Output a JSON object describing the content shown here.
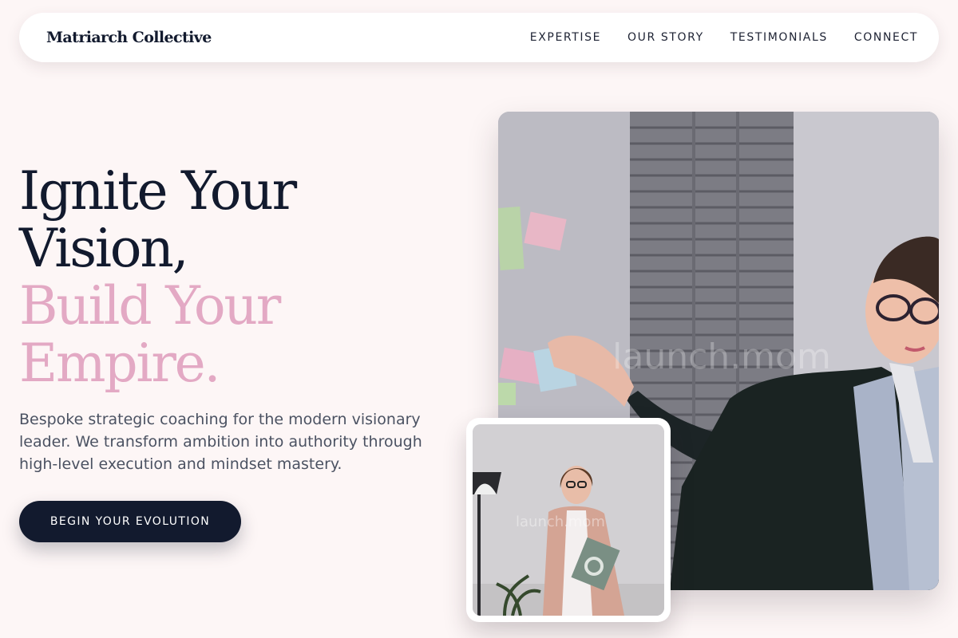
{
  "brand": {
    "name": "Matriarch Collective"
  },
  "nav": {
    "items": [
      {
        "label": "EXPERTISE"
      },
      {
        "label": "OUR STORY"
      },
      {
        "label": "TESTIMONIALS"
      },
      {
        "label": "CONNECT"
      }
    ]
  },
  "hero": {
    "headline_line1": "Ignite Your",
    "headline_line2": "Vision,",
    "headline_line3": "Build Your",
    "headline_line4": "Empire.",
    "subtext": "Bespoke strategic coaching for the modern visionary leader. We transform ambition into authority through high-level execution and mindset mastery.",
    "cta_label": "BEGIN YOUR EVOLUTION"
  },
  "images": {
    "main_watermark": "launch.mom",
    "small_watermark": "launch.mom"
  },
  "colors": {
    "background": "#fdf6f6",
    "navy": "#121a2e",
    "accent_pink": "#e3a9c4"
  }
}
